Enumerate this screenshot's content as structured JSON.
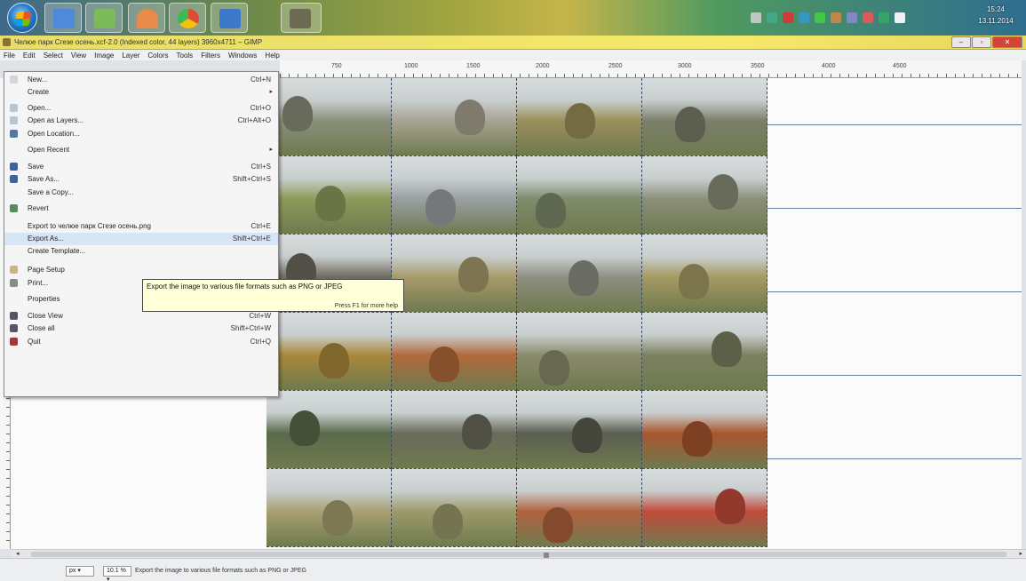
{
  "taskbar": {
    "apps": [
      {
        "name": "start-orb"
      },
      {
        "name": "taskbar-app-1",
        "color": "#4f8ad8"
      },
      {
        "name": "taskbar-app-2",
        "color": "#7dbb5a"
      },
      {
        "name": "taskbar-app-3",
        "color": "#e88a4a"
      },
      {
        "name": "taskbar-app-chrome",
        "color": "#dd4b39"
      },
      {
        "name": "taskbar-app-doc",
        "color": "#3b78c9"
      },
      {
        "name": "taskbar-app-gimp",
        "color": "#6c6a50"
      }
    ],
    "clock_time": "15:24",
    "clock_date": "13.11.2014"
  },
  "window": {
    "title": "Челюе парк Сгезе осень.xcf-2.0 (Indexed color, 44 layers) 3960x4711 – GIMP",
    "controls": {
      "minimize": "–",
      "maximize": "▫",
      "close": "✕"
    }
  },
  "menubar": [
    "File",
    "Edit",
    "Select",
    "View",
    "Image",
    "Layer",
    "Colors",
    "Tools",
    "Filters",
    "Windows",
    "Help"
  ],
  "ruler": {
    "ticks": [
      "750",
      "1000",
      "1500",
      "2000",
      "2500",
      "3000",
      "3500",
      "4000",
      "4500"
    ]
  },
  "file_menu": {
    "items": [
      {
        "label": "New...",
        "shortcut": "Ctrl+N",
        "icon": "new-icon",
        "color": "#cfd6de"
      },
      {
        "label": "Create",
        "shortcut": "",
        "submenu": true
      },
      {
        "label": "Open...",
        "shortcut": "Ctrl+O",
        "icon": "open-icon",
        "color": "#b7c5d4"
      },
      {
        "label": "Open as Layers...",
        "shortcut": "Ctrl+Alt+O",
        "icon": "open-layers-icon",
        "color": "#b7c5d4"
      },
      {
        "label": "Open Location...",
        "shortcut": "",
        "icon": "globe-icon",
        "color": "#4f7aa8"
      },
      {
        "label": "Open Recent",
        "shortcut": "",
        "submenu": true
      },
      {
        "label": "Save",
        "shortcut": "Ctrl+S",
        "icon": "save-icon",
        "color": "#3a64a8"
      },
      {
        "label": "Save As...",
        "shortcut": "Shift+Ctrl+S",
        "icon": "save-as-icon",
        "color": "#3a64a8"
      },
      {
        "label": "Save a Copy...",
        "shortcut": ""
      },
      {
        "label": "Revert",
        "shortcut": "",
        "icon": "revert-icon",
        "color": "#5a8a5a"
      },
      {
        "label": "Export to челюе парк Сгезе осень.png",
        "shortcut": "Ctrl+E"
      },
      {
        "label": "Export As...",
        "shortcut": "Shift+Ctrl+E",
        "highlighted": true
      },
      {
        "label": "Create Template...",
        "shortcut": ""
      },
      {
        "label": "Page Setup",
        "shortcut": "",
        "icon": "page-setup-icon",
        "color": "#c9b87a"
      },
      {
        "label": "Print...",
        "shortcut": "Ctrl+P",
        "icon": "print-icon",
        "color": "#8a8a8a"
      },
      {
        "label": "Properties",
        "shortcut": ""
      },
      {
        "label": "Close View",
        "shortcut": "Ctrl+W",
        "icon": "close-view-icon",
        "color": "#556"
      },
      {
        "label": "Close all",
        "shortcut": "Shift+Ctrl+W",
        "icon": "close-all-icon",
        "color": "#556"
      },
      {
        "label": "Quit",
        "shortcut": "Ctrl+Q",
        "icon": "quit-icon",
        "color": "#a33"
      }
    ]
  },
  "tooltip": {
    "text": "Export the image to various file formats such as PNG or JPEG",
    "hint": "Press F1 for more help"
  },
  "statusbar": {
    "unit": "px",
    "zoom": "10.1 %",
    "message": "Export the image to various file formats such as PNG or JPEG"
  },
  "photo_palette": [
    [
      "#8a8f7a",
      "#a8a392",
      "#9a8e5a",
      "#7b7f6a"
    ],
    [
      "#8d9a5a",
      "#9aa0a2",
      "#7e8a6a",
      "#8b8f78"
    ],
    [
      "#6e6a5e",
      "#a79a6a",
      "#8e8f82",
      "#a59a62"
    ],
    [
      "#a8883a",
      "#b26a3a",
      "#8a8a6a",
      "#7c8060"
    ],
    [
      "#5a6a4a",
      "#6a6a5a",
      "#5a5e50",
      "#a8562e"
    ],
    [
      "#a6a070",
      "#9c9a6a",
      "#b0623e",
      "#c24a3a"
    ]
  ]
}
